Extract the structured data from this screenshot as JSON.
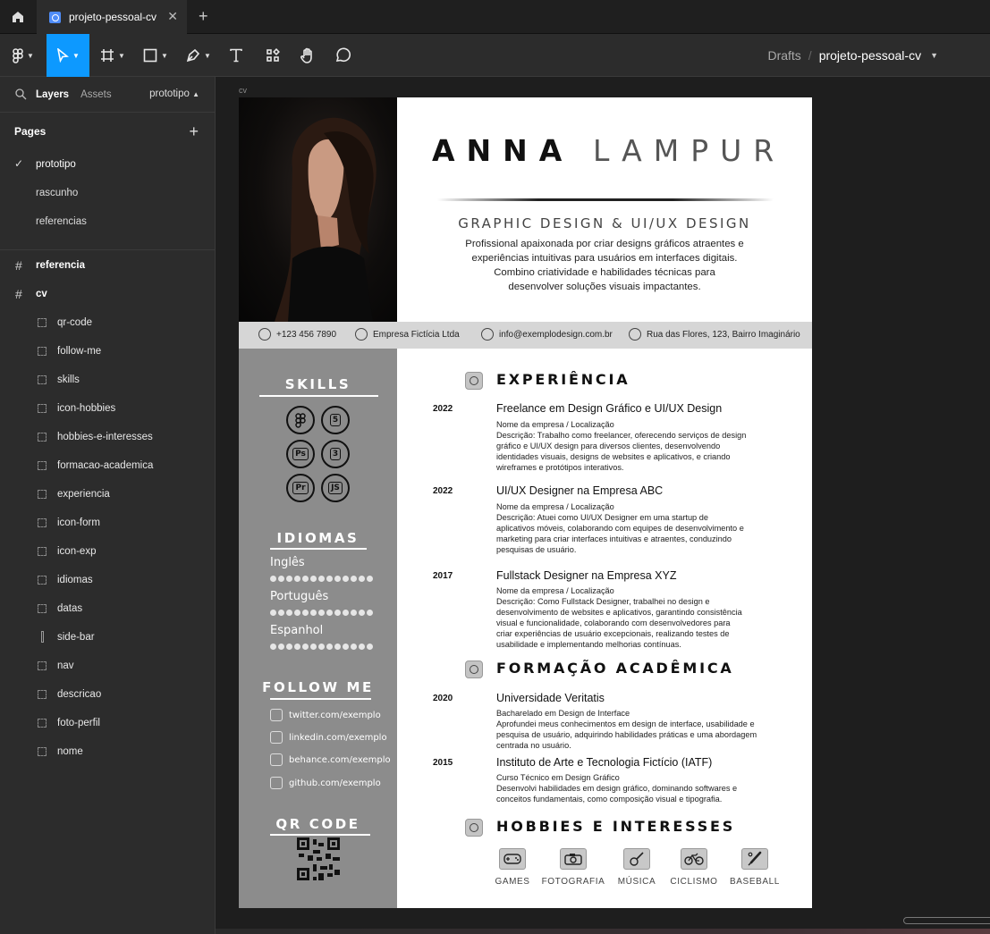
{
  "tabbar": {
    "tab_title": "projeto-pessoal-cv"
  },
  "toolbar": {
    "breadcrumb_drafts": "Drafts",
    "breadcrumb_sep": "/",
    "breadcrumb_file": "projeto-pessoal-cv"
  },
  "left_panel": {
    "tab_layers": "Layers",
    "tab_assets": "Assets",
    "page_selector": "prototipo",
    "pages_title": "Pages",
    "pages": [
      "prototipo",
      "rascunho",
      "referencias"
    ],
    "frames": [
      "referencia",
      "cv"
    ],
    "cv_children": [
      "qr-code",
      "follow-me",
      "skills",
      "icon-hobbies",
      "hobbies-e-interesses",
      "formacao-academica",
      "experiencia",
      "icon-form",
      "icon-exp",
      "idiomas",
      "datas",
      "side-bar",
      "nav",
      "descricao",
      "foto-perfil",
      "nome"
    ]
  },
  "canvas": {
    "frame_label": "cv"
  },
  "cv": {
    "name_first": "ANNA",
    "name_last": "LAMPUR",
    "role": "GRAPHIC DESIGN & UI/UX DESIGN",
    "description": [
      "Profissional apaixonada por criar designs gráficos atraentes e",
      "experiências intuitivas para usuários em interfaces digitais.",
      "Combino criatividade e habilidades técnicas para",
      "desenvolver soluções visuais impactantes."
    ],
    "contact": {
      "phone": "+123 456 7890",
      "company": "Empresa Fictícia Ltda",
      "email": "info@exemplodesign.com.br",
      "address": "Rua das Flores, 123, Bairro Imaginário"
    },
    "sidebar": {
      "skills_title": "SKILLS",
      "skills": [
        "figma-icon",
        "html5-icon",
        "photoshop-icon",
        "css3-icon",
        "premiere-icon",
        "javascript-icon"
      ],
      "skills_labels": [
        "",
        "5",
        "Ps",
        "3",
        "Pr",
        "JS"
      ],
      "languages_title": "IDIOMAS",
      "languages": [
        "Inglês",
        "Português",
        "Espanhol"
      ],
      "follow_title": "FOLLOW ME",
      "follow": [
        "twitter.com/exemplo",
        "linkedin.com/exemplo",
        "behance.com/exemplo",
        "github.com/exemplo"
      ],
      "qr_title": "QR CODE"
    },
    "experience_title": "EXPERIÊNCIA",
    "experience": [
      {
        "year": "2022",
        "title": "Freelance em Design Gráfico e UI/UX Design",
        "lines": [
          "Nome da empresa / Localização",
          "Descrição: Trabalho como freelancer, oferecendo serviços de design",
          "gráfico e UI/UX design para diversos clientes, desenvolvendo",
          "identidades visuais, designs de websites e aplicativos, e criando",
          "wireframes e protótipos interativos."
        ]
      },
      {
        "year": "2022",
        "title": "UI/UX Designer na Empresa ABC",
        "lines": [
          "Nome da empresa / Localização",
          "Descrição: Atuei como UI/UX Designer em uma startup de",
          "aplicativos móveis, colaborando com equipes de desenvolvimento e",
          "marketing para criar interfaces intuitivas e atraentes, conduzindo",
          "pesquisas de usuário."
        ]
      },
      {
        "year": "2017",
        "title": "Fullstack Designer na Empresa XYZ",
        "lines": [
          "Nome da empresa / Localização",
          "Descrição: Como Fullstack Designer, trabalhei no design e",
          "desenvolvimento de websites e aplicativos, garantindo consistência",
          "visual e funcionalidade, colaborando com desenvolvedores para",
          "criar experiências de usuário excepcionais, realizando testes de",
          "usabilidade e implementando melhorias contínuas."
        ]
      }
    ],
    "education_title": "FORMAÇÃO ACADÊMICA",
    "education": [
      {
        "year": "2020",
        "title": "Universidade Veritatis",
        "lines": [
          "Bacharelado em Design de Interface",
          "Aprofundei meus conhecimentos em design de interface, usabilidade e",
          "pesquisa de usuário, adquirindo habilidades práticas e uma abordagem",
          "centrada no usuário."
        ]
      },
      {
        "year": "2015",
        "title": "Instituto de Arte e Tecnologia Fictício (IATF)",
        "lines": [
          "Curso Técnico em Design Gráfico",
          "Desenvolvi habilidades em design gráfico, dominando softwares e",
          "conceitos fundamentais, como composição visual e tipografia."
        ]
      }
    ],
    "hobbies_title": "HOBBIES E INTERESSES",
    "hobbies": [
      {
        "label": "GAMES",
        "icon": "gamepad-icon"
      },
      {
        "label": "FOTOGRAFIA",
        "icon": "camera-icon"
      },
      {
        "label": "MÚSICA",
        "icon": "guitar-icon"
      },
      {
        "label": "CICLISMO",
        "icon": "bicycle-icon"
      },
      {
        "label": "BASEBALL",
        "icon": "baseball-bat-icon"
      }
    ]
  }
}
